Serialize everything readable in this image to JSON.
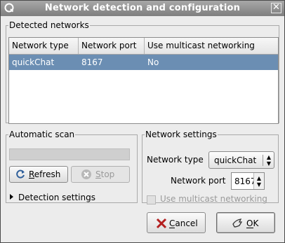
{
  "window": {
    "title": "Network detection and configuration",
    "close_glyph": "✕"
  },
  "detected": {
    "legend": "Detected networks",
    "columns": [
      "Network type",
      "Network port",
      "Use multicast networking"
    ],
    "rows": [
      {
        "type": "quickChat",
        "port": "8167",
        "multicast": "No",
        "selected": true
      }
    ]
  },
  "scan": {
    "legend": "Automatic scan",
    "progress": 0,
    "refresh_label": "Refresh",
    "stop_label": "Stop",
    "detection_settings": "Detection settings"
  },
  "settings": {
    "legend": "Network settings",
    "type_label": "Network type",
    "type_value": "quickChat",
    "port_label": "Network port",
    "port_value": "8167",
    "multicast_label": "Use multicast networking",
    "multicast_checked": false
  },
  "buttons": {
    "cancel": "Cancel",
    "ok": "OK"
  },
  "colors": {
    "selection": "#6b8eb3",
    "titlebar": "#8f8f8f"
  }
}
